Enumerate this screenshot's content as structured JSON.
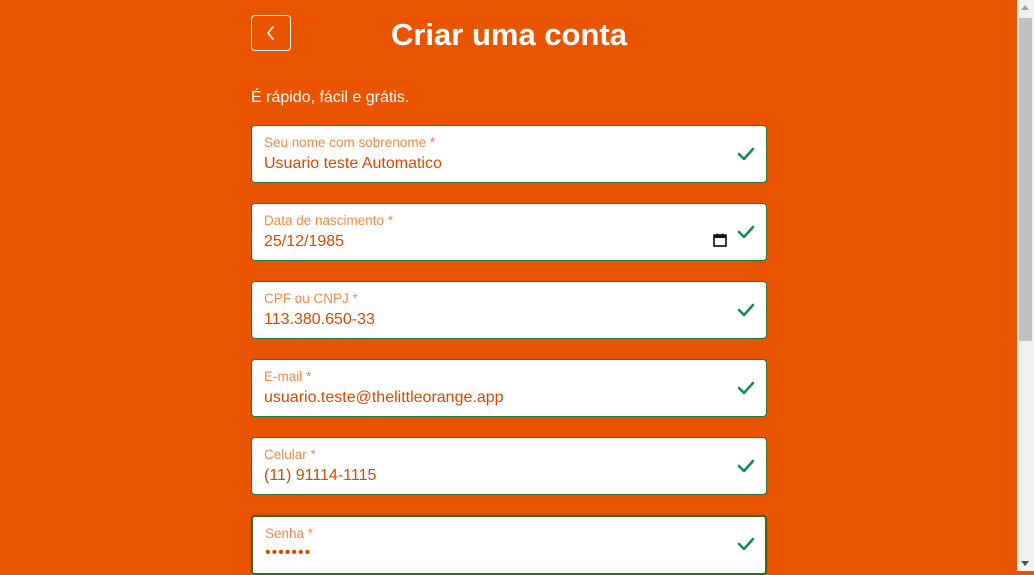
{
  "header": {
    "title": "Criar uma conta",
    "back_icon": "chevron-left-icon"
  },
  "subtitle": "É rápido, fácil e grátis.",
  "fields": {
    "name": {
      "label": "Seu nome com sobrenome *",
      "value": "Usuario teste Automatico",
      "valid": true
    },
    "birthdate": {
      "label": "Data de nascimento *",
      "value": "25/12/1985",
      "valid": true,
      "icon": "calendar-icon"
    },
    "document": {
      "label": "CPF ou CNPJ *",
      "value": "113.380.650-33",
      "valid": true
    },
    "email": {
      "label": "E-mail *",
      "value": "usuario.teste@thelittleorange.app",
      "valid": true
    },
    "phone": {
      "label": "Celular *",
      "value": "(11) 91114-1115",
      "valid": true
    },
    "password": {
      "label": "Senha *",
      "value": "•••••••",
      "valid": true
    }
  },
  "colors": {
    "background": "#ea5400",
    "label": "#f08a44",
    "value": "#d94a00",
    "check": "#1a8a55",
    "field_border": "#1f7a3f"
  }
}
